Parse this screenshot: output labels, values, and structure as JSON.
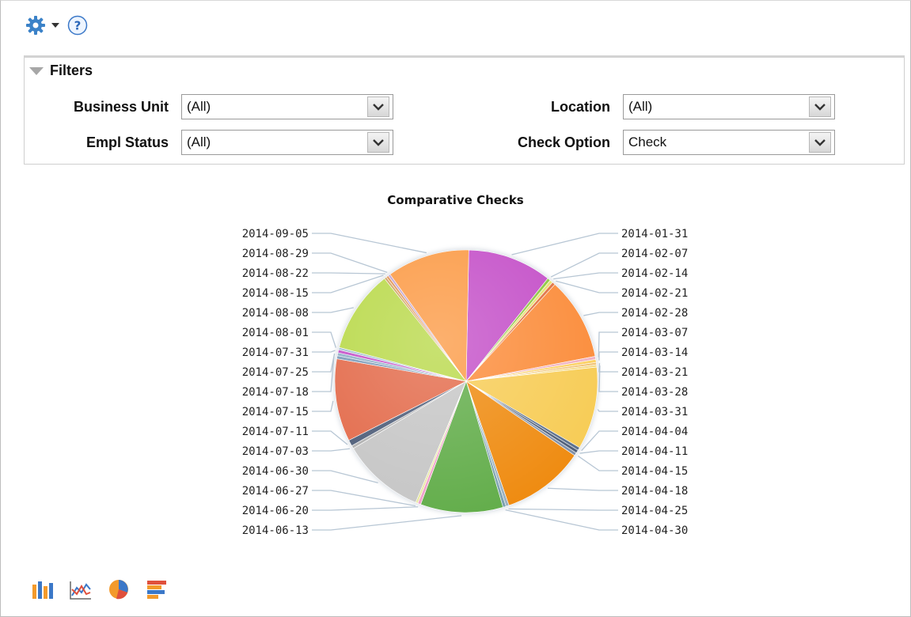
{
  "filters": {
    "title": "Filters",
    "business_unit": {
      "label": "Business Unit",
      "value": "(All)"
    },
    "location": {
      "label": "Location",
      "value": "(All)"
    },
    "empl_status": {
      "label": "Empl Status",
      "value": "(All)"
    },
    "check_option": {
      "label": "Check Option",
      "value": "Check"
    }
  },
  "chart_data": {
    "type": "pie",
    "title": "Comparative Checks",
    "series": [
      {
        "values": [
          {
            "label": "2014-01-31",
            "value": 11.0,
            "color": "#c44fc8"
          },
          {
            "label": "2014-02-07",
            "value": 0.4,
            "color": "#8cc63f"
          },
          {
            "label": "2014-02-14",
            "value": 0.4,
            "color": "#e8e070"
          },
          {
            "label": "2014-02-21",
            "value": 0.4,
            "color": "#e07040"
          },
          {
            "label": "2014-02-28",
            "value": 10.8,
            "color": "#fb8c3a"
          },
          {
            "label": "2014-03-07",
            "value": 0.4,
            "color": "#f0b0c0"
          },
          {
            "label": "2014-03-14",
            "value": 0.4,
            "color": "#fcd060"
          },
          {
            "label": "2014-03-21",
            "value": 0.3,
            "color": "#f0c070"
          },
          {
            "label": "2014-03-28",
            "value": 0.3,
            "color": "#f4d880"
          },
          {
            "label": "2014-03-31",
            "value": 10.8,
            "color": "#f7cc55"
          },
          {
            "label": "2014-04-04",
            "value": 0.4,
            "color": "#5a6f8c"
          },
          {
            "label": "2014-04-11",
            "value": 0.4,
            "color": "#4e5e78"
          },
          {
            "label": "2014-04-15",
            "value": 0.4,
            "color": "#8090a8"
          },
          {
            "label": "2014-04-18",
            "value": 10.8,
            "color": "#ef8b10"
          },
          {
            "label": "2014-04-25",
            "value": 0.4,
            "color": "#9ab0c0"
          },
          {
            "label": "2014-04-30",
            "value": 0.4,
            "color": "#7aa0b0"
          },
          {
            "label": "2014-06-13",
            "value": 10.8,
            "color": "#62ad4a"
          },
          {
            "label": "2014-06-20",
            "value": 0.4,
            "color": "#f0a0c8"
          },
          {
            "label": "2014-06-27",
            "value": 0.3,
            "color": "#e8e8a0"
          },
          {
            "label": "2014-06-30",
            "value": 10.8,
            "color": "#c6c6c6"
          },
          {
            "label": "2014-07-03",
            "value": 0.4,
            "color": "#b0b0b0"
          },
          {
            "label": "2014-07-11",
            "value": 0.8,
            "color": "#4c5c78"
          },
          {
            "label": "2014-07-15",
            "value": 10.8,
            "color": "#e36a4a"
          },
          {
            "label": "2014-07-18",
            "value": 0.4,
            "color": "#7a9ab8"
          },
          {
            "label": "2014-07-25",
            "value": 0.4,
            "color": "#90b0c8"
          },
          {
            "label": "2014-07-31",
            "value": 0.4,
            "color": "#c44fc8"
          },
          {
            "label": "2014-08-01",
            "value": 0.3,
            "color": "#a0c0d0"
          },
          {
            "label": "2014-08-08",
            "value": 10.8,
            "color": "#b9d94a"
          },
          {
            "label": "2014-08-15",
            "value": 0.3,
            "color": "#d0a060"
          },
          {
            "label": "2014-08-22",
            "value": 0.3,
            "color": "#e09050"
          },
          {
            "label": "2014-08-29",
            "value": 0.3,
            "color": "#c0a0d0"
          },
          {
            "label": "2014-09-05",
            "value": 10.8,
            "color": "#fb9a45"
          }
        ]
      }
    ],
    "legend_right": [
      "2014-01-31",
      "2014-02-07",
      "2014-02-14",
      "2014-02-21",
      "2014-02-28",
      "2014-03-07",
      "2014-03-14",
      "2014-03-21",
      "2014-03-28",
      "2014-03-31",
      "2014-04-04",
      "2014-04-11",
      "2014-04-15",
      "2014-04-18",
      "2014-04-25",
      "2014-04-30"
    ],
    "legend_left": [
      "2014-09-05",
      "2014-08-29",
      "2014-08-22",
      "2014-08-15",
      "2014-08-08",
      "2014-08-01",
      "2014-07-31",
      "2014-07-25",
      "2014-07-18",
      "2014-07-15",
      "2014-07-11",
      "2014-07-03",
      "2014-06-30",
      "2014-06-27",
      "2014-06-20",
      "2014-06-13"
    ]
  },
  "icons": {
    "toolbar": [
      "gear-icon",
      "chevron-down-icon",
      "help-icon"
    ],
    "chart_types": [
      "bar-chart-icon",
      "line-chart-icon",
      "pie-chart-icon",
      "stacked-bar-chart-icon"
    ]
  }
}
